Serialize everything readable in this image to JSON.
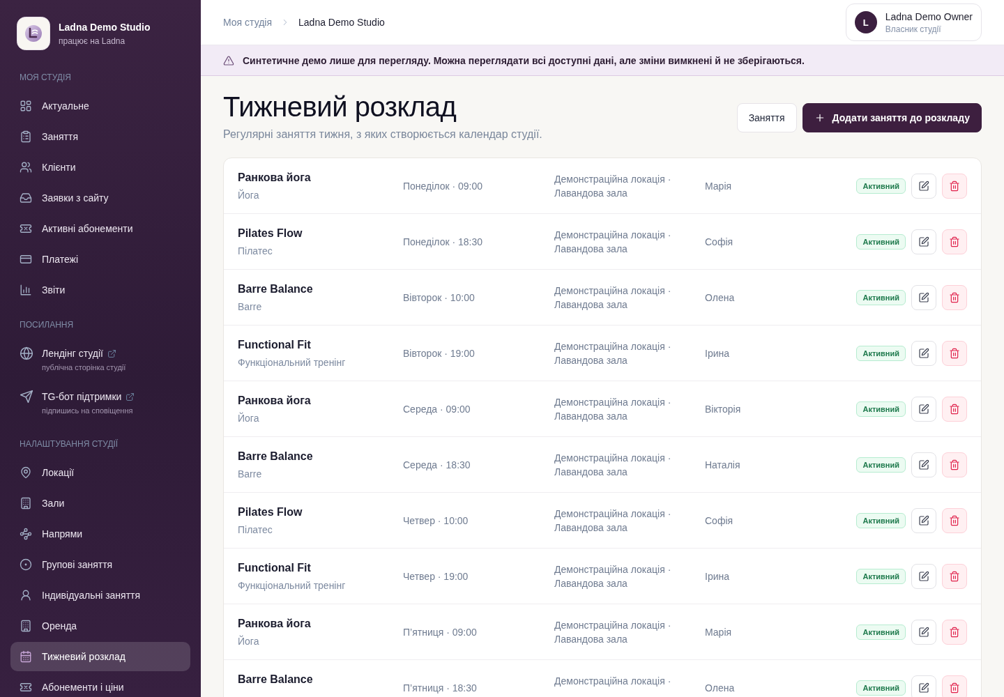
{
  "sidebar": {
    "brand": {
      "name": "Ladna Demo Studio",
      "tagline": "працює на Ladna"
    },
    "sections": [
      {
        "heading": "МОЯ СТУДІЯ",
        "items": [
          {
            "kind": "page",
            "label": "Актуальне",
            "selected": false
          },
          {
            "kind": "page",
            "label": "Заняття",
            "selected": false
          },
          {
            "kind": "page",
            "label": "Клієнти",
            "selected": false
          },
          {
            "kind": "page",
            "label": "Заявки з сайту",
            "selected": false
          },
          {
            "kind": "page",
            "label": "Активні абонементи",
            "selected": false
          },
          {
            "kind": "page",
            "label": "Платежі",
            "selected": false
          },
          {
            "kind": "page",
            "label": "Звіти",
            "selected": false
          }
        ]
      },
      {
        "heading": "ПОСИЛАННЯ",
        "items": [
          {
            "kind": "link",
            "label": "Лендінг студії",
            "hint": "публічна сторінка студії",
            "selected": false
          },
          {
            "kind": "link",
            "label": "TG-бот підтримки",
            "hint": "підпишись на сповіщення",
            "selected": false
          }
        ]
      },
      {
        "heading": "НАЛАШТУВАННЯ СТУДІЇ",
        "items": [
          {
            "kind": "page",
            "label": "Локації",
            "selected": false
          },
          {
            "kind": "page",
            "label": "Зали",
            "selected": false
          },
          {
            "kind": "page",
            "label": "Напрями",
            "selected": false
          },
          {
            "kind": "page",
            "label": "Групові заняття",
            "selected": false
          },
          {
            "kind": "page",
            "label": "Індивідуальні заняття",
            "selected": false
          },
          {
            "kind": "page",
            "label": "Оренда",
            "selected": false
          },
          {
            "kind": "page",
            "label": "Тижневий розклад",
            "selected": true
          },
          {
            "kind": "page",
            "label": "Абонементи і ціни",
            "selected": false
          }
        ]
      }
    ]
  },
  "header": {
    "breadcrumbs": [
      {
        "label": "Моя студія",
        "current": false
      },
      {
        "label": "Ladna Demo Studio",
        "current": true
      }
    ],
    "user": {
      "initial": "L",
      "name": "Ladna Demo Owner",
      "role": "Власник студії"
    }
  },
  "banner": {
    "text": "Синтетичне демо лише для перегляду. Можна переглядати всі доступні дані, але зміни вимкнені й не зберігаються."
  },
  "page": {
    "title": "Тижневий розклад",
    "subtitle": "Регулярні заняття тижня, з яких створюється календар студії.",
    "actions": [
      {
        "kind": "secondary",
        "label": "Заняття"
      },
      {
        "kind": "primary",
        "label": "Додати заняття до розкладу"
      }
    ]
  },
  "schedule": {
    "rows": [
      {
        "title": "Ранкова йога",
        "category": "Йога",
        "time": "Понеділок · 09:00",
        "location": "Демонстраційна локація · Лавандова зала",
        "instructor": "Марія",
        "status": "Активний"
      },
      {
        "title": "Pilates Flow",
        "category": "Пілатес",
        "time": "Понеділок · 18:30",
        "location": "Демонстраційна локація · Лавандова зала",
        "instructor": "Софія",
        "status": "Активний"
      },
      {
        "title": "Barre Balance",
        "category": "Barre",
        "time": "Вівторок · 10:00",
        "location": "Демонстраційна локація · Лавандова зала",
        "instructor": "Олена",
        "status": "Активний"
      },
      {
        "title": "Functional Fit",
        "category": "Функціональний тренінг",
        "time": "Вівторок · 19:00",
        "location": "Демонстраційна локація · Лавандова зала",
        "instructor": "Ірина",
        "status": "Активний"
      },
      {
        "title": "Ранкова йога",
        "category": "Йога",
        "time": "Середа · 09:00",
        "location": "Демонстраційна локація · Лавандова зала",
        "instructor": "Вікторія",
        "status": "Активний"
      },
      {
        "title": "Barre Balance",
        "category": "Barre",
        "time": "Середа · 18:30",
        "location": "Демонстраційна локація · Лавандова зала",
        "instructor": "Наталія",
        "status": "Активний"
      },
      {
        "title": "Pilates Flow",
        "category": "Пілатес",
        "time": "Четвер · 10:00",
        "location": "Демонстраційна локація · Лавандова зала",
        "instructor": "Софія",
        "status": "Активний"
      },
      {
        "title": "Functional Fit",
        "category": "Функціональний тренінг",
        "time": "Четвер · 19:00",
        "location": "Демонстраційна локація · Лавандова зала",
        "instructor": "Ірина",
        "status": "Активний"
      },
      {
        "title": "Ранкова йога",
        "category": "Йога",
        "time": "П’ятниця · 09:00",
        "location": "Демонстраційна локація · Лавандова зала",
        "instructor": "Марія",
        "status": "Активний"
      },
      {
        "title": "Barre Balance",
        "time": "П’ятниця · 18:30",
        "location": "Демонстраційна локація ·",
        "instructor": "Олена",
        "status": "Активний"
      }
    ]
  }
}
